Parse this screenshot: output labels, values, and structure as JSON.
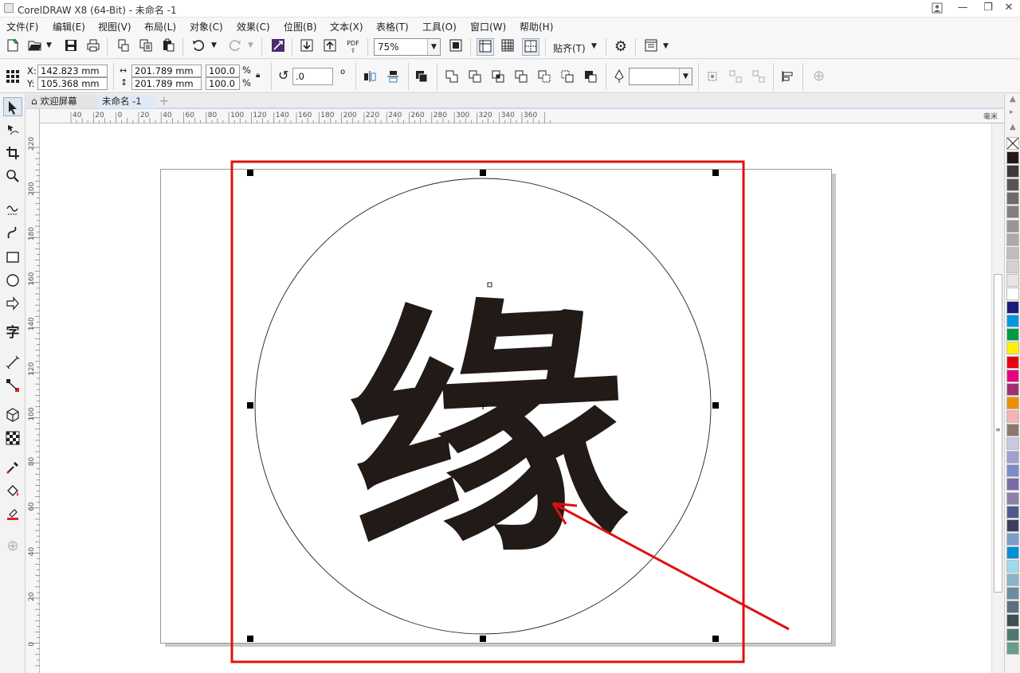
{
  "app": {
    "title": "CorelDRAW X8 (64-Bit) - 未命名 -1",
    "window_buttons": [
      "user-icon",
      "minimize-icon",
      "restore-icon",
      "close-icon"
    ]
  },
  "menu": [
    "文件(F)",
    "编辑(E)",
    "视图(V)",
    "布局(L)",
    "对象(C)",
    "效果(C)",
    "位图(B)",
    "文本(X)",
    "表格(T)",
    "工具(O)",
    "窗口(W)",
    "帮助(H)"
  ],
  "toolbar": {
    "zoom_value": "75%",
    "snap_label": "贴齐(T)",
    "pdf_label": "PDF",
    "icons": [
      "new-document-icon",
      "open-icon",
      "save-icon",
      "print-icon",
      "cut-icon",
      "copy-icon",
      "paste-icon",
      "undo-icon",
      "redo-icon",
      "corel-connect-icon",
      "import-icon",
      "export-icon",
      "publish-pdf-icon",
      "zoom-dropdown",
      "full-screen-icon",
      "show-rulers-icon",
      "show-grid-icon",
      "show-guidelines-icon",
      "snap-to-dropdown",
      "options-gear-icon",
      "launcher-icon"
    ]
  },
  "property_bar": {
    "x_label": "X:",
    "y_label": "Y:",
    "x_value": "142.823 mm",
    "y_value": "105.368 mm",
    "width_value": "201.789 mm",
    "height_value": "201.789 mm",
    "scale_w": "100.0",
    "scale_h": "100.0",
    "percent": "%",
    "rotation": ".0",
    "degree": "o"
  },
  "tabs": [
    {
      "label": "欢迎屏幕",
      "icon": "home-icon",
      "active": false
    },
    {
      "label": "未命名 -1",
      "active": true
    }
  ],
  "ruler": {
    "unit": "毫米",
    "h_labels": [
      "40",
      "20",
      "0",
      "20",
      "40",
      "60",
      "80",
      "100",
      "120",
      "140",
      "160",
      "180",
      "200",
      "220",
      "240",
      "260",
      "280",
      "300",
      "320",
      "340",
      "360"
    ],
    "v_labels": [
      "220",
      "200",
      "180",
      "160",
      "140",
      "120",
      "100",
      "80",
      "60",
      "40",
      "20",
      "0"
    ]
  },
  "canvas": {
    "glyph": "缘",
    "glyph_color": "#221a16",
    "highlight_color": "#e01010",
    "arrow_color": "#e01010"
  },
  "toolbox_icons": [
    "pick-tool-icon",
    "shape-tool-icon",
    "crop-tool-icon",
    "zoom-tool-icon",
    "freehand-tool-icon",
    "artistic-media-icon",
    "rectangle-tool-icon",
    "ellipse-tool-icon",
    "polygon-tool-icon",
    "text-tool-icon",
    "parallel-dimension-icon",
    "connector-tool-icon",
    "blend-tool-icon",
    "transparency-tool-icon",
    "eyedropper-icon",
    "interactive-fill-icon",
    "smart-fill-icon",
    "add-tool-icon"
  ],
  "text_tool_glyph": "字",
  "palette": [
    "#231815",
    "#3b3b3b",
    "#555555",
    "#6b6b6b",
    "#808080",
    "#969696",
    "#aaaaaa",
    "#bebebe",
    "#d2d2d2",
    "#e6e6e6",
    "#ffffff",
    "#1a1e78",
    "#0096e0",
    "#009944",
    "#fff000",
    "#e60012",
    "#e4007f",
    "#a0306e",
    "#f18d00",
    "#f5b4b4",
    "#8c7a6c",
    "#c8c8e0",
    "#a0a0d0",
    "#7a8cc8",
    "#7a6aa8",
    "#8a80a8",
    "#4e5c8c",
    "#3e3e5e",
    "#7aa0c8",
    "#0090d8",
    "#a0d8ef",
    "#8cb4c8",
    "#6a8ca0",
    "#5c7080",
    "#3c5050",
    "#4c7a70",
    "#6a9c8c"
  ]
}
